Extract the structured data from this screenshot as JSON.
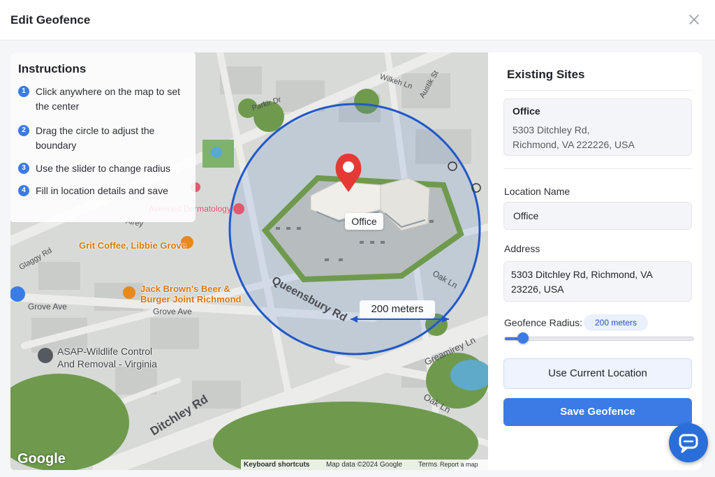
{
  "modal": {
    "title": "Edit Geofence",
    "close_icon": "close-icon"
  },
  "instructions": {
    "title": "Instructions",
    "items": [
      {
        "num": "1",
        "text": "Click anywhere on the map to set the center"
      },
      {
        "num": "2",
        "text": "Drag the circle to adjust  the boundary"
      },
      {
        "num": "3",
        "text": "Use the slider to change radius"
      },
      {
        "num": "4",
        "text": "Fill in location details and save"
      }
    ]
  },
  "map": {
    "streets": {
      "parkir": "Parkir Dr",
      "wilkeh": "Wilkeh Ln",
      "austik": "Austik St",
      "glaggy": "Glaggy Rd",
      "airey": "Airey",
      "grove1": "Grove Ave",
      "grove2": "Grove Ave",
      "queensbury": "Queensbury Rd",
      "oak1": "Oak Ln",
      "oak2": "Oak Ln",
      "greamirey": "Greamirey Ln",
      "ditchley": "Ditchley Rd"
    },
    "pois": {
      "avenues": "Avenues Dermatology",
      "grit": "Grit Coffee, Libbie Grove",
      "jack_line1": "Jack Brown's Beer &",
      "jack_line2": "Burger Joint Richmond",
      "asap_line1": "ASAP-Wildlife Control",
      "asap_line2": "And Removal - Virginia"
    },
    "marker_label": "Office",
    "radius_label": "200 meters",
    "google_logo": "Google",
    "attribution": {
      "shortcuts": "Keyboard shortcuts",
      "mapdata": "Map data ©2024 Google",
      "terms": "Terms",
      "report": "Report a map erro"
    },
    "colors": {
      "circle": "#2058c9",
      "pin": "#e53935"
    }
  },
  "panel": {
    "existing_title": "Existing Sites",
    "site": {
      "name": "Office",
      "addr_line1": "5303 Ditchley Rd,",
      "addr_line2": "Richmond, VA 222226,  USA"
    },
    "location_name_label": "Location Name",
    "location_name_value": "Office",
    "address_label": "Address",
    "address_line1": "5303 Ditchley Rd, Richmond, VA",
    "address_line2": "23226, USA",
    "radius_label": "Geofence Radius:",
    "radius_value": "200 meters",
    "slider_fraction": 0.07,
    "use_current": "Use Current Location",
    "save": "Save Geofence",
    "accent": "#3b7be5"
  },
  "chat": {
    "icon": "chat-icon"
  }
}
